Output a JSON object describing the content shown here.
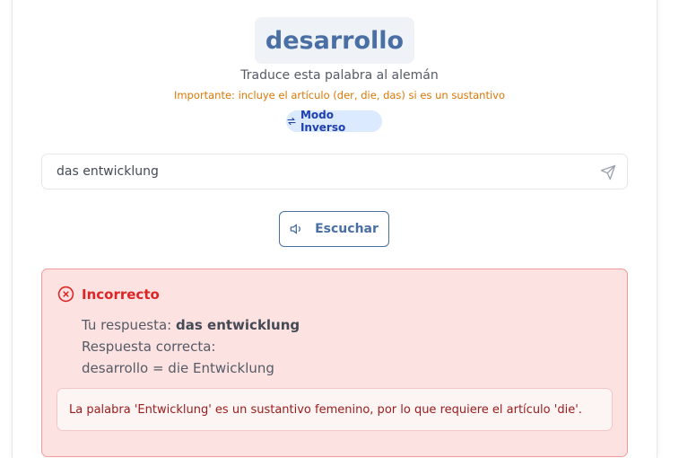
{
  "prompt": {
    "word": "desarrollo",
    "instruction": "Traduce esta palabra al alemán",
    "note": "Importante: incluye el artículo (der, die, das) si es un sustantivo",
    "mode_label": "Modo Inverso"
  },
  "answer": {
    "value": "das entwicklung",
    "send_icon": "send-icon"
  },
  "listen": {
    "label": "Escuchar",
    "icon": "speaker-icon"
  },
  "result": {
    "title": "Incorrecto",
    "your_answer_label": "Tu respuesta: ",
    "your_answer_value": "das entwicklung",
    "correct_label": "Respuesta correcta:",
    "correct_value": "desarrollo = die Entwicklung",
    "explanation": "La palabra 'Entwicklung' es un sustantivo femenino, por lo que requiere el artículo 'die'."
  },
  "colors": {
    "accent": "#4a6fa5",
    "error": "#dc2626",
    "warning": "#d97706",
    "pill_bg": "#dbeafe"
  }
}
